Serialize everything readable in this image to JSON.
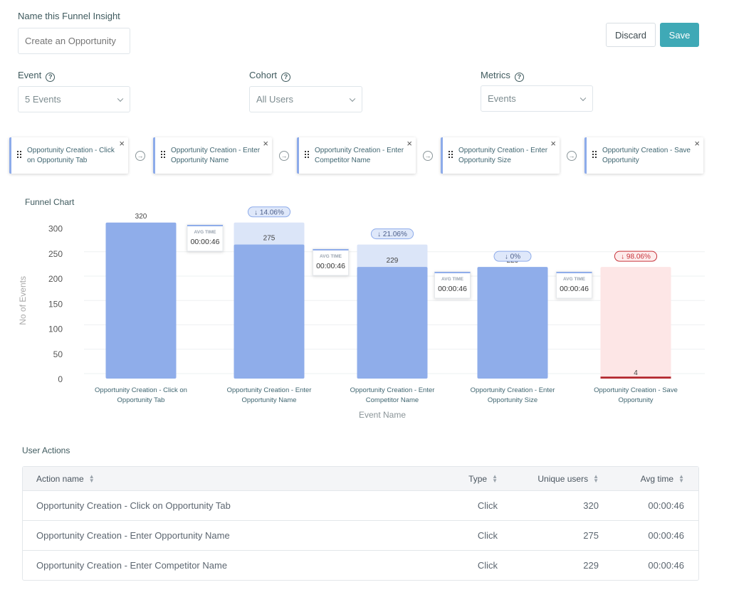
{
  "header": {
    "name_label": "Name this Funnel Insight",
    "name_placeholder": "Create an Opportunity",
    "discard_label": "Discard",
    "save_label": "Save"
  },
  "filters": {
    "event": {
      "label": "Event",
      "value": "5 Events",
      "help_icon": "question-circle-icon"
    },
    "cohort": {
      "label": "Cohort",
      "value": "All Users",
      "help_icon": "question-circle-icon"
    },
    "metrics": {
      "label": "Metrics",
      "value": "Events",
      "help_icon": "question-circle-icon"
    }
  },
  "steps": [
    {
      "label": "Opportunity Creation - Click on Opportunity Tab"
    },
    {
      "label": "Opportunity Creation - Enter Opportunity Name"
    },
    {
      "label": "Opportunity Creation - Enter Competitor Name"
    },
    {
      "label": "Opportunity Creation - Enter Opportunity Size"
    },
    {
      "label": "Opportunity Creation - Save Opportunity"
    }
  ],
  "icons": {
    "close": "×",
    "arrow": "→",
    "help": "?"
  },
  "colors": {
    "bar": "#8fadea",
    "bar_ghost": "#dbe5f8",
    "bar_dropoff_ghost": "#fde6e6",
    "bar_dropoff_line": "#b3262d",
    "badge_bg": "#dfe8fa",
    "badge_border": "#8dabea",
    "badge_red_bg": "#fdecec",
    "badge_red_border": "#c7333a",
    "accent": "#3fa9b6"
  },
  "chart_data": {
    "type": "bar",
    "title": "Funnel Chart",
    "xlabel": "Event Name",
    "ylabel": "No of  Events",
    "ylim": [
      0,
      320
    ],
    "yticks": [
      0,
      50,
      100,
      150,
      200,
      250,
      300
    ],
    "grid": true,
    "categories": [
      "Opportunity Creation - Click on Opportunity Tab",
      "Opportunity Creation - Enter Opportunity Name",
      "Opportunity Creation - Enter Competitor Name",
      "Opportunity Creation - Enter Opportunity Size",
      "Opportunity Creation - Save Opportunity"
    ],
    "category_lines": [
      [
        "Opportunity Creation - Click on",
        "Opportunity Tab"
      ],
      [
        "Opportunity Creation - Enter",
        "Opportunity Name"
      ],
      [
        "Opportunity Creation - Enter",
        "Competitor Name"
      ],
      [
        "Opportunity Creation - Enter",
        "Opportunity Size"
      ],
      [
        "Opportunity Creation - Save",
        "Opportunity"
      ]
    ],
    "values": [
      320,
      275,
      229,
      229,
      4
    ],
    "dropoff": [
      null,
      "14.06%",
      "21.06%",
      "0%",
      "98.06%"
    ],
    "dropoff_severity": [
      null,
      "normal",
      "normal",
      "normal",
      "high"
    ],
    "avg_time_label": "AVG TIME",
    "avg_times": [
      "00:00:46",
      "00:00:46",
      "00:00:46",
      "00:00:46"
    ]
  },
  "user_actions": {
    "title": "User Actions",
    "columns": [
      "Action name",
      "Type",
      "Unique users",
      "Avg time"
    ],
    "rows": [
      [
        "Opportunity Creation - Click on Opportunity Tab",
        "Click",
        "320",
        "00:00:46"
      ],
      [
        "Opportunity Creation - Enter Opportunity Name",
        "Click",
        "275",
        "00:00:46"
      ],
      [
        "Opportunity Creation - Enter Competitor Name",
        "Click",
        "229",
        "00:00:46"
      ]
    ]
  }
}
